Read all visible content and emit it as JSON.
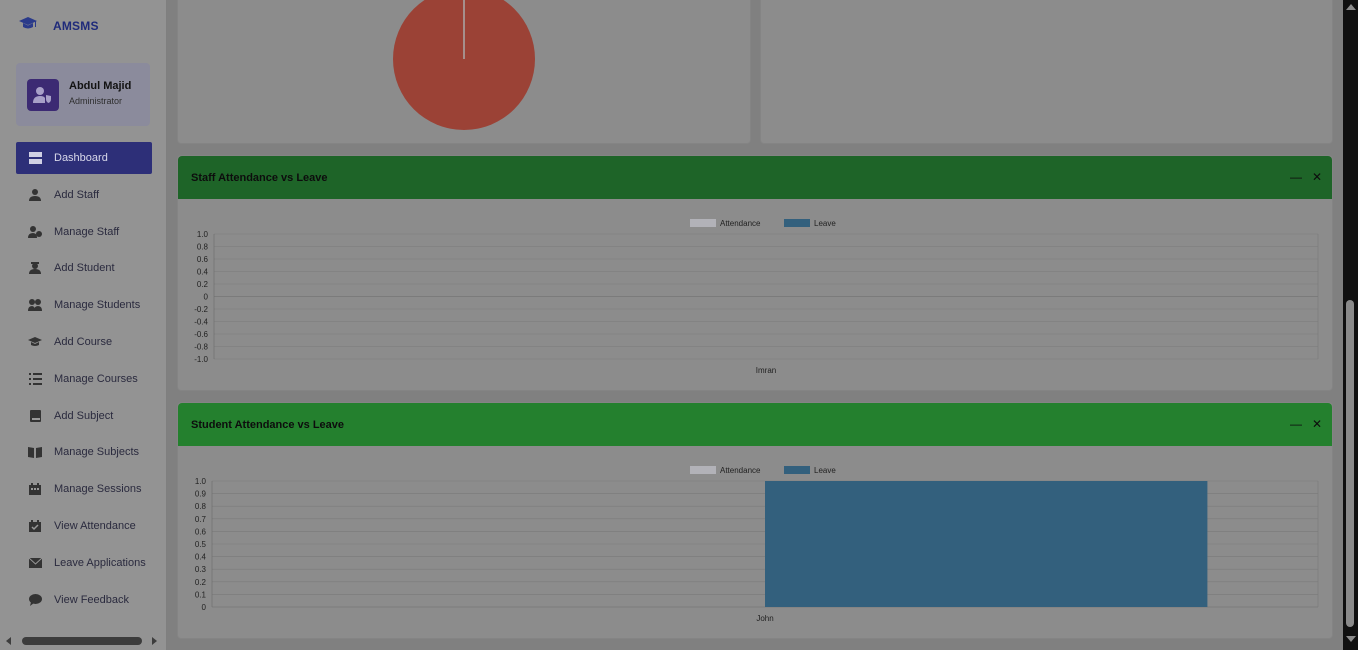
{
  "app": {
    "brand": "AMSMS"
  },
  "user": {
    "name": "Abdul Majid",
    "role": "Administrator"
  },
  "sidebar": {
    "items": [
      {
        "label": "Dashboard",
        "icon": "dashboard-icon",
        "active": true
      },
      {
        "label": "Add Staff",
        "icon": "user-tie-icon"
      },
      {
        "label": "Manage Staff",
        "icon": "users-cog-icon"
      },
      {
        "label": "Add Student",
        "icon": "user-graduate-icon"
      },
      {
        "label": "Manage Students",
        "icon": "users-icon"
      },
      {
        "label": "Add Course",
        "icon": "graduation-cap-icon"
      },
      {
        "label": "Manage Courses",
        "icon": "tasks-icon"
      },
      {
        "label": "Add Subject",
        "icon": "book-icon"
      },
      {
        "label": "Manage Subjects",
        "icon": "book-open-icon"
      },
      {
        "label": "Manage Sessions",
        "icon": "calendar-icon"
      },
      {
        "label": "View Attendance",
        "icon": "calendar-check-icon"
      },
      {
        "label": "Leave Applications",
        "icon": "envelope-icon"
      },
      {
        "label": "View Feedback",
        "icon": "comment-icon"
      }
    ]
  },
  "cards": {
    "staff": {
      "title": "Staff Attendance vs Leave",
      "minimize": "—",
      "close": "✕"
    },
    "student": {
      "title": "Student Attendance vs Leave",
      "minimize": "—",
      "close": "✕"
    }
  },
  "colors": {
    "attendance": "#b2b2b8",
    "leave": "#33607d",
    "pie": "#9b4236",
    "header_staff": "#1e6428",
    "header_student": "#24802e",
    "active_nav": "#2d2f78"
  },
  "chart_data": [
    {
      "type": "pie",
      "values": [
        1
      ]
    },
    {
      "type": "bar",
      "title": "Staff Attendance vs Leave",
      "categories": [
        "Imran"
      ],
      "series": [
        {
          "name": "Attendance",
          "values": [
            0
          ]
        },
        {
          "name": "Leave",
          "values": [
            0
          ]
        }
      ],
      "ylim": [
        -1.0,
        1.0
      ],
      "yticks": [
        "1.0",
        "0.8",
        "0.6",
        "0.4",
        "0.2",
        "0",
        "-0.2",
        "-0.4",
        "-0.6",
        "-0.8",
        "-1.0"
      ],
      "legend": "top-center",
      "grid": true
    },
    {
      "type": "bar",
      "title": "Student Attendance vs Leave",
      "categories": [
        "John"
      ],
      "series": [
        {
          "name": "Attendance",
          "values": [
            0
          ]
        },
        {
          "name": "Leave",
          "values": [
            1
          ]
        }
      ],
      "ylim": [
        0,
        1.0
      ],
      "yticks": [
        "1.0",
        "0.9",
        "0.8",
        "0.7",
        "0.6",
        "0.5",
        "0.4",
        "0.3",
        "0.2",
        "0.1",
        "0"
      ],
      "legend": "top-center",
      "grid": true
    }
  ]
}
